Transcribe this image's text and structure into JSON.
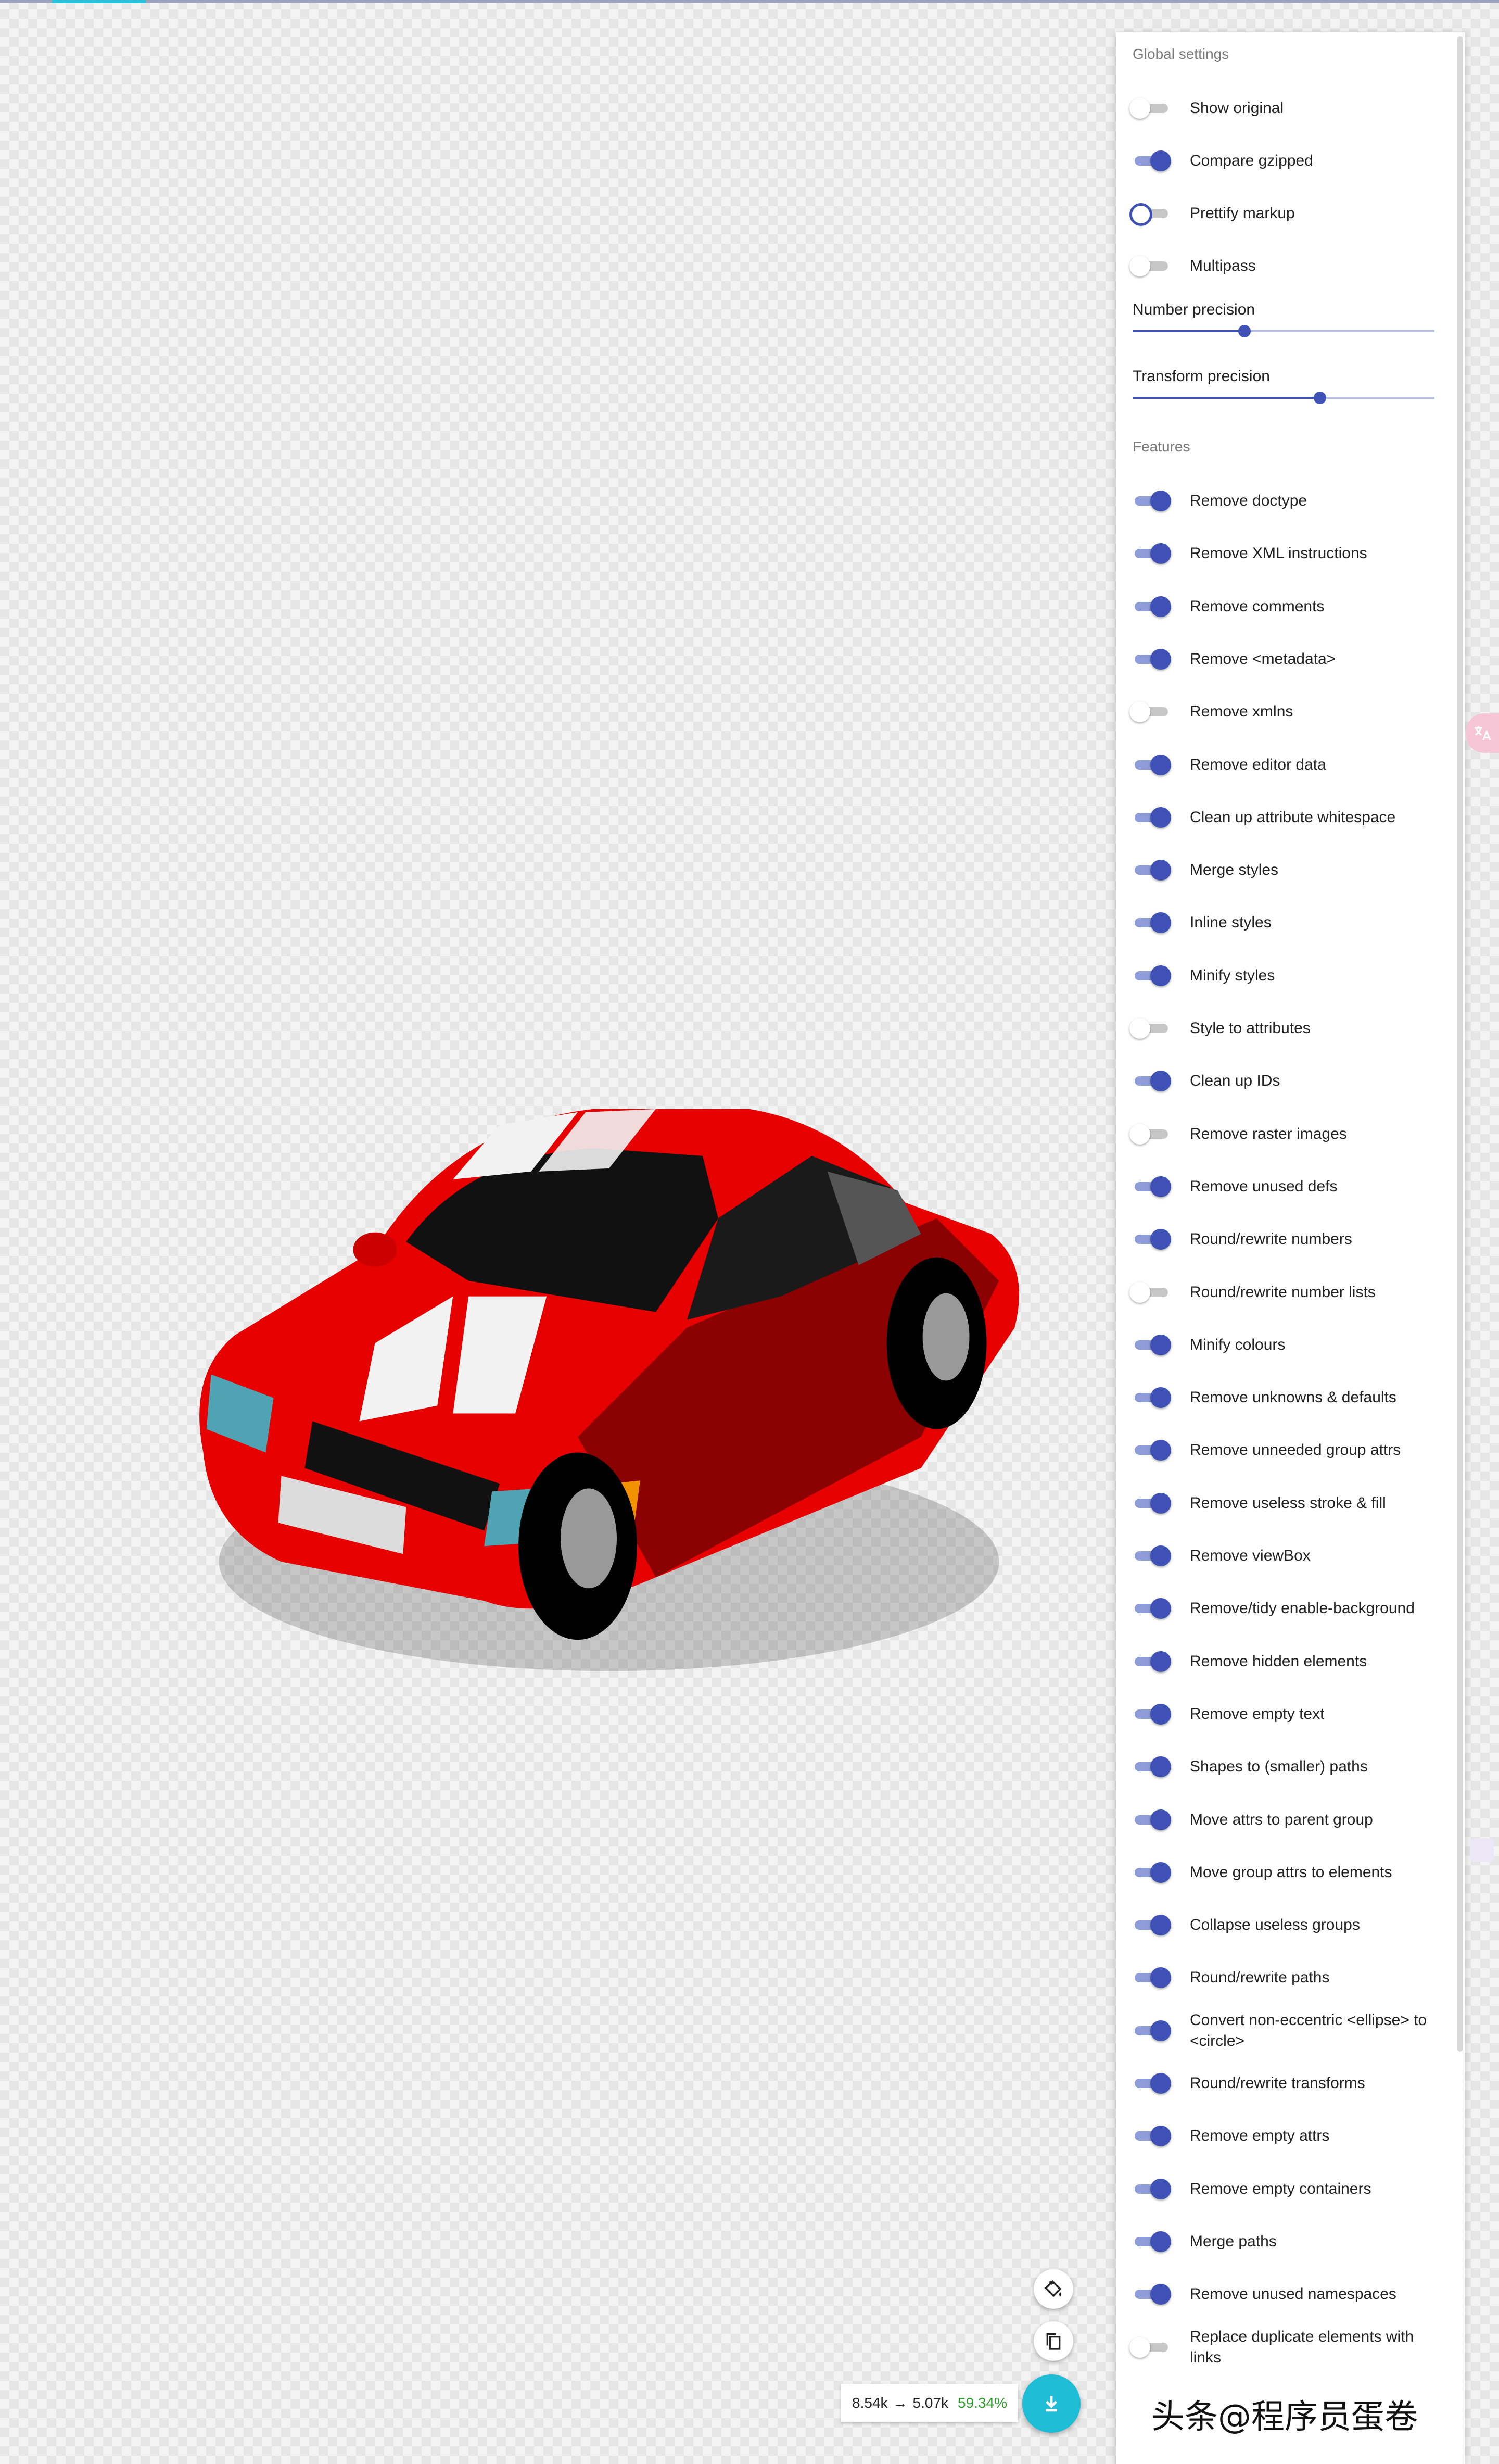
{
  "settings": {
    "global_title": "Global settings",
    "global": [
      {
        "label": "Show original",
        "on": false
      },
      {
        "label": "Compare gzipped",
        "on": true
      },
      {
        "label": "Prettify markup",
        "on": false,
        "focused": true
      },
      {
        "label": "Multipass",
        "on": false
      }
    ],
    "sliders": [
      {
        "label": "Number precision",
        "value_fraction": 0.37
      },
      {
        "label": "Transform precision",
        "value_fraction": 0.62
      }
    ],
    "features_title": "Features",
    "features": [
      {
        "label": "Remove doctype",
        "on": true
      },
      {
        "label": "Remove XML instructions",
        "on": true
      },
      {
        "label": "Remove comments",
        "on": true
      },
      {
        "label": "Remove <metadata>",
        "on": true
      },
      {
        "label": "Remove xmlns",
        "on": false
      },
      {
        "label": "Remove editor data",
        "on": true
      },
      {
        "label": "Clean up attribute whitespace",
        "on": true
      },
      {
        "label": "Merge styles",
        "on": true
      },
      {
        "label": "Inline styles",
        "on": true
      },
      {
        "label": "Minify styles",
        "on": true
      },
      {
        "label": "Style to attributes",
        "on": false
      },
      {
        "label": "Clean up IDs",
        "on": true
      },
      {
        "label": "Remove raster images",
        "on": false
      },
      {
        "label": "Remove unused defs",
        "on": true
      },
      {
        "label": "Round/rewrite numbers",
        "on": true
      },
      {
        "label": "Round/rewrite number lists",
        "on": false
      },
      {
        "label": "Minify colours",
        "on": true
      },
      {
        "label": "Remove unknowns & defaults",
        "on": true
      },
      {
        "label": "Remove unneeded group attrs",
        "on": true
      },
      {
        "label": "Remove useless stroke & fill",
        "on": true
      },
      {
        "label": "Remove viewBox",
        "on": true
      },
      {
        "label": "Remove/tidy enable-background",
        "on": true
      },
      {
        "label": "Remove hidden elements",
        "on": true
      },
      {
        "label": "Remove empty text",
        "on": true
      },
      {
        "label": "Shapes to (smaller) paths",
        "on": true
      },
      {
        "label": "Move attrs to parent group",
        "on": true
      },
      {
        "label": "Move group attrs to elements",
        "on": true
      },
      {
        "label": "Collapse useless groups",
        "on": true
      },
      {
        "label": "Round/rewrite paths",
        "on": true
      },
      {
        "label": "Convert non-eccentric <ellipse> to <circle>",
        "on": true
      },
      {
        "label": "Round/rewrite transforms",
        "on": true
      },
      {
        "label": "Remove empty attrs",
        "on": true
      },
      {
        "label": "Remove empty containers",
        "on": true
      },
      {
        "label": "Merge paths",
        "on": true
      },
      {
        "label": "Remove unused namespaces",
        "on": true
      },
      {
        "label": "Replace duplicate elements with links",
        "on": false
      }
    ]
  },
  "stats": {
    "from": "8.54k",
    "arrow": "→",
    "to": "5.07k",
    "percent": "59.34%"
  },
  "icons": {
    "paint": "paint-bucket-icon",
    "copy": "copy-icon",
    "download": "download-icon",
    "translate": "translate-icon"
  },
  "colors": {
    "accent": "#3f51b5",
    "fab": "#1fbcd6",
    "car_red": "#e60000"
  },
  "watermark": "头条@程序员蛋卷"
}
